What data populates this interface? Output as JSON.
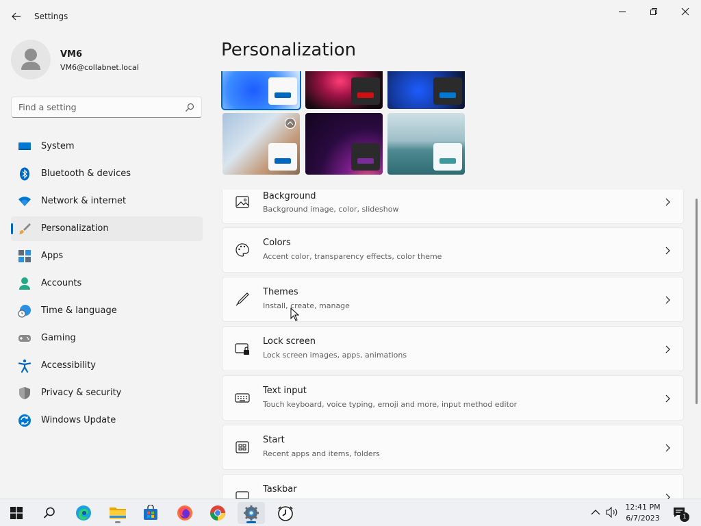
{
  "window": {
    "title": "Settings",
    "controls": [
      "minimize",
      "restore",
      "close"
    ]
  },
  "profile": {
    "name": "VM6",
    "email": "VM6@collabnet.local"
  },
  "search": {
    "placeholder": "Find a setting",
    "value": ""
  },
  "sidebar": {
    "items": [
      {
        "label": "System",
        "icon": "system-icon"
      },
      {
        "label": "Bluetooth & devices",
        "icon": "bluetooth-icon"
      },
      {
        "label": "Network & internet",
        "icon": "wifi-icon"
      },
      {
        "label": "Personalization",
        "icon": "brush-icon",
        "active": true
      },
      {
        "label": "Apps",
        "icon": "apps-icon"
      },
      {
        "label": "Accounts",
        "icon": "accounts-icon"
      },
      {
        "label": "Time & language",
        "icon": "time-language-icon"
      },
      {
        "label": "Gaming",
        "icon": "gamepad-icon"
      },
      {
        "label": "Accessibility",
        "icon": "accessibility-icon"
      },
      {
        "label": "Privacy & security",
        "icon": "shield-icon"
      },
      {
        "label": "Windows Update",
        "icon": "windows-update-icon"
      }
    ]
  },
  "main": {
    "title": "Personalization",
    "themes": [
      {
        "name": "windows-light",
        "selected": true
      },
      {
        "name": "glow"
      },
      {
        "name": "windows-dark"
      },
      {
        "name": "captured-motion"
      },
      {
        "name": "sunrise"
      },
      {
        "name": "flow"
      }
    ],
    "cards": [
      {
        "title": "Background",
        "subtitle": "Background image, color, slideshow",
        "icon": "image-icon"
      },
      {
        "title": "Colors",
        "subtitle": "Accent color, transparency effects, color theme",
        "icon": "palette-icon"
      },
      {
        "title": "Themes",
        "subtitle": "Install, create, manage",
        "icon": "pen-icon"
      },
      {
        "title": "Lock screen",
        "subtitle": "Lock screen images, apps, animations",
        "icon": "lock-screen-icon"
      },
      {
        "title": "Text input",
        "subtitle": "Touch keyboard, voice typing, emoji and more, input method editor",
        "icon": "keyboard-icon"
      },
      {
        "title": "Start",
        "subtitle": "Recent apps and items, folders",
        "icon": "start-menu-icon"
      },
      {
        "title": "Taskbar",
        "subtitle": "",
        "icon": "taskbar-icon"
      }
    ]
  },
  "taskbar": {
    "apps": [
      "start-icon",
      "search-icon",
      "edge-icon",
      "file-explorer-icon",
      "store-icon",
      "firefox-icon",
      "chrome-icon",
      "settings-icon",
      "clock-app-icon"
    ],
    "clock": {
      "time": "12:41 PM",
      "date": "6/7/2023"
    },
    "notification_count": "1"
  },
  "colors": {
    "accent": "#0067c0"
  }
}
